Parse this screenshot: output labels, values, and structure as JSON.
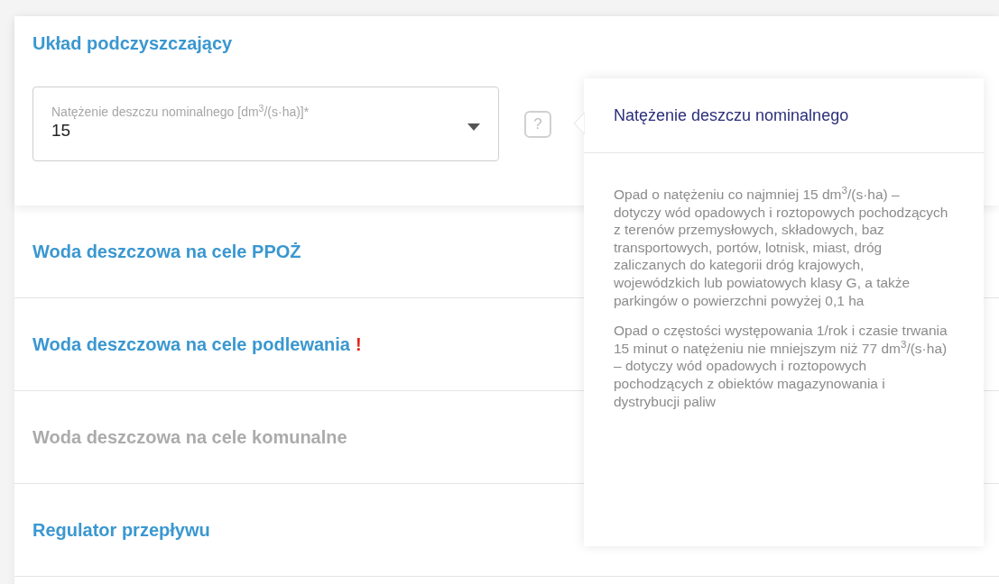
{
  "top_section": {
    "title": "Układ podczyszczający",
    "field": {
      "label": "Natężenie deszczu nominalnego [dm$^{3}$/(s·ha)]*",
      "value": "15"
    },
    "help_icon": "?"
  },
  "sections": [
    {
      "title": "Woda deszczowa na cele PPOŻ",
      "disabled": false
    },
    {
      "title": "Woda deszczowa na cele podlewania",
      "disabled": false,
      "badge": "!"
    },
    {
      "title": "Woda deszczowa na cele komunalne",
      "disabled": true
    },
    {
      "title": "Regulator przepływu",
      "disabled": false
    }
  ],
  "tooltip": {
    "title": "Natężenie deszczu nominalnego",
    "paragraphs": [
      "Opad o natężeniu co najmniej 15 dm$^{3}$/(s·ha) – dotyczy wód opadowych i roztopowych pochodzących z terenów przemysłowych, składowych, baz transportowych, portów, lotnisk, miast, dróg zaliczanych do kategorii dróg krajowych, wojewódzkich lub powiatowych klasy G, a także parkingów o powierzchni powyżej 0,1 ha",
      "Opad o częstości występowania 1/rok i czasie trwania 15 minut o natężeniu nie mniejszym niż 77 dm$^{3}$/(s·ha) – dotyczy wód opadowych i roztopowych pochodzących z obiektów magazynowania i dystrybucji paliw"
    ]
  }
}
